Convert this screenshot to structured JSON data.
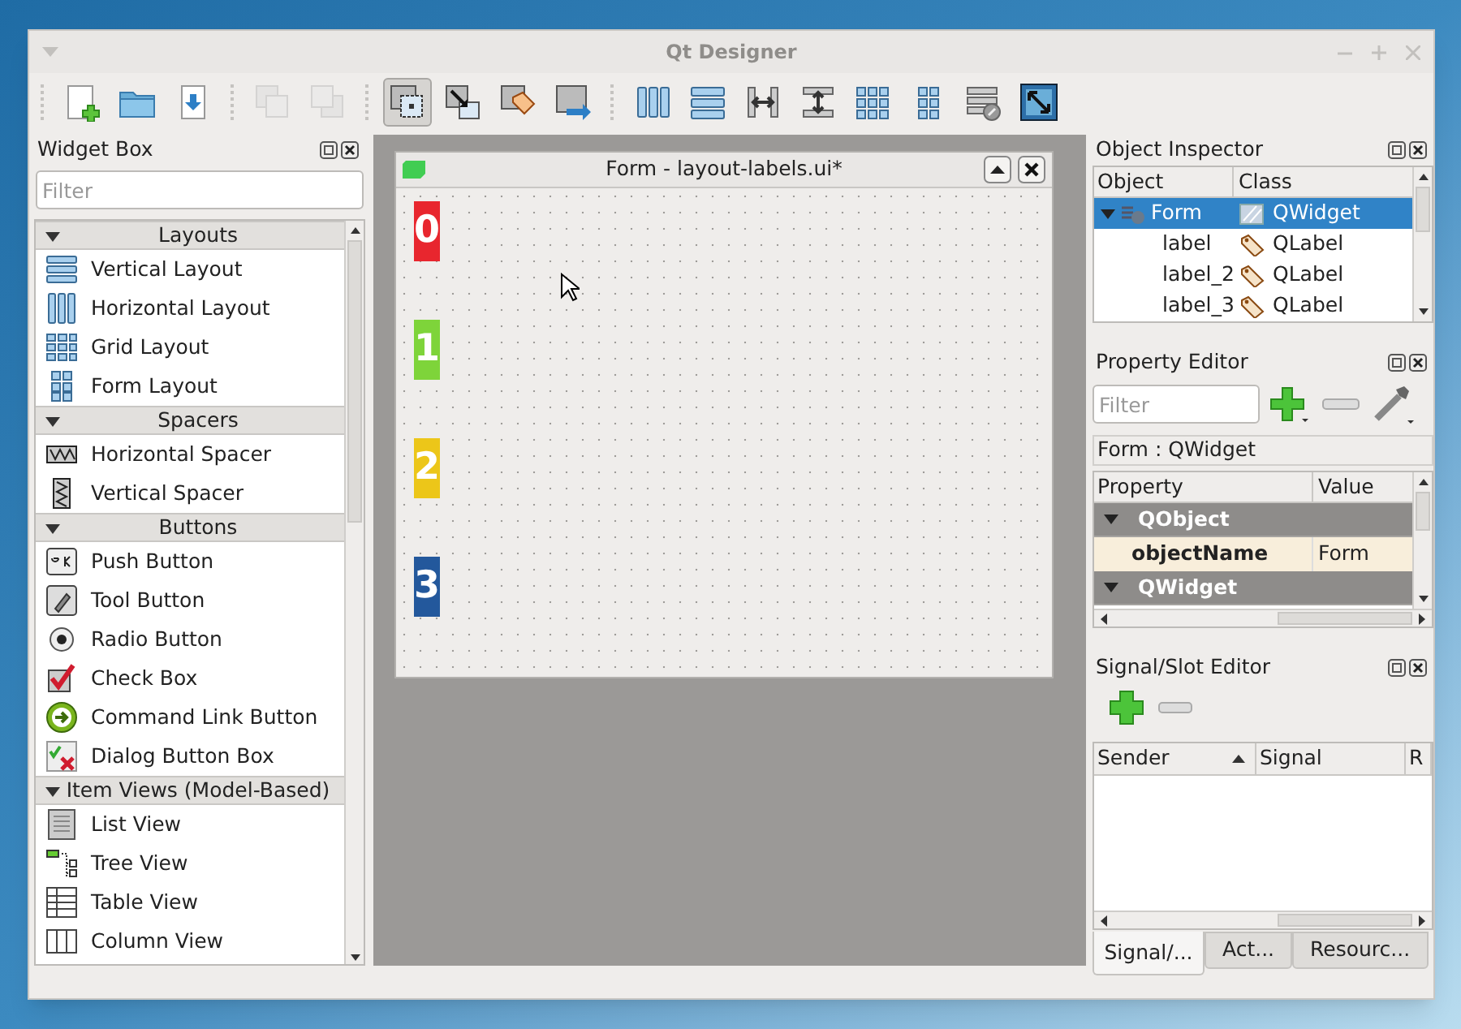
{
  "window": {
    "title": "Qt Designer"
  },
  "toolbar": {
    "buttons": [
      {
        "kind": "new",
        "selected": false,
        "disabled": false
      },
      {
        "kind": "open",
        "selected": false,
        "disabled": false
      },
      {
        "kind": "save",
        "selected": false,
        "disabled": false
      },
      {
        "kind": "front",
        "selected": false,
        "disabled": true
      },
      {
        "kind": "back",
        "selected": false,
        "disabled": true
      },
      {
        "kind": "edit-widgets",
        "selected": true,
        "disabled": false
      },
      {
        "kind": "edit-signals",
        "selected": false,
        "disabled": false
      },
      {
        "kind": "edit-buddies",
        "selected": false,
        "disabled": false
      },
      {
        "kind": "edit-tab-order",
        "selected": false,
        "disabled": false
      },
      {
        "kind": "hlayout",
        "selected": false,
        "disabled": false
      },
      {
        "kind": "vlayout",
        "selected": false,
        "disabled": false
      },
      {
        "kind": "hsplit",
        "selected": false,
        "disabled": false
      },
      {
        "kind": "vsplit",
        "selected": false,
        "disabled": false
      },
      {
        "kind": "grid",
        "selected": false,
        "disabled": false
      },
      {
        "kind": "form",
        "selected": false,
        "disabled": false
      },
      {
        "kind": "break",
        "selected": false,
        "disabled": false
      },
      {
        "kind": "adjust",
        "selected": false,
        "disabled": false
      }
    ]
  },
  "widget_box": {
    "title": "Widget Box",
    "filter": {
      "placeholder": "Filter"
    },
    "sections": [
      {
        "title": "Layouts",
        "expanded": true,
        "items": [
          "Vertical Layout",
          "Horizontal Layout",
          "Grid Layout",
          "Form Layout"
        ]
      },
      {
        "title": "Spacers",
        "expanded": true,
        "items": [
          "Horizontal Spacer",
          "Vertical Spacer"
        ]
      },
      {
        "title": "Buttons",
        "expanded": true,
        "items": [
          "Push Button",
          "Tool Button",
          "Radio Button",
          "Check Box",
          "Command Link Button",
          "Dialog Button Box"
        ]
      },
      {
        "title": "Item Views (Model-Based)",
        "expanded": true,
        "items": [
          "List View",
          "Tree View",
          "Table View",
          "Column View"
        ]
      }
    ]
  },
  "form": {
    "title": "Form - layout-labels.ui*",
    "labels": [
      {
        "text": "0",
        "color": "#e8262e"
      },
      {
        "text": "1",
        "color": "#7ed43a"
      },
      {
        "text": "2",
        "color": "#ecc619"
      },
      {
        "text": "3",
        "color": "#23589c"
      }
    ]
  },
  "object_inspector": {
    "title": "Object Inspector",
    "columns": [
      "Object",
      "Class"
    ],
    "rows": [
      {
        "object": "Form",
        "class": "QWidget",
        "selected": true,
        "expanded": true,
        "children": [
          {
            "object": "label",
            "class": "QLabel",
            "selected": false
          },
          {
            "object": "label_2",
            "class": "QLabel",
            "selected": false
          },
          {
            "object": "label_3",
            "class": "QLabel",
            "selected": false
          }
        ]
      }
    ]
  },
  "property_editor": {
    "title": "Property Editor",
    "filter": {
      "placeholder": "Filter"
    },
    "object": "Form : QWidget",
    "columns": [
      "Property",
      "Value"
    ],
    "rows": [
      {
        "kind": "group",
        "name": "QObject",
        "expanded": true
      },
      {
        "kind": "property",
        "name": "objectName",
        "value": "Form"
      },
      {
        "kind": "group",
        "name": "QWidget",
        "expanded": true
      }
    ]
  },
  "signal_slot_editor": {
    "title": "Signal/Slot Editor",
    "columns": [
      {
        "label": "Sender",
        "sorted": true
      },
      {
        "label": "Signal",
        "sorted": false
      },
      {
        "label": "R",
        "sorted": false
      }
    ]
  },
  "bottom_tabs": [
    {
      "label": "Signal/...",
      "selected": true
    },
    {
      "label": "Act...",
      "selected": false
    },
    {
      "label": "Resourc...",
      "selected": false
    }
  ]
}
